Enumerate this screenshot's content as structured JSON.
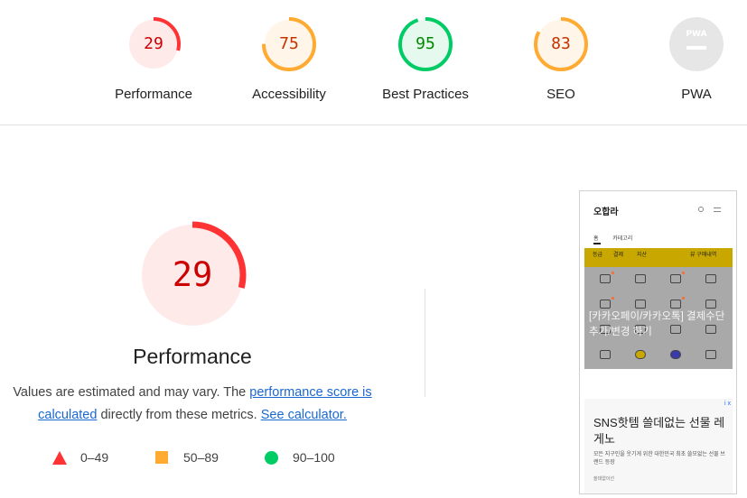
{
  "scores": [
    {
      "label": "Performance",
      "value": "29",
      "fraction": 0.29,
      "color": "#ff3333",
      "text_color": "#cc0000",
      "bg": "#ffeaea"
    },
    {
      "label": "Accessibility",
      "value": "75",
      "fraction": 0.75,
      "color": "#ffaa33",
      "text_color": "#c33300",
      "bg": "#fff5e8"
    },
    {
      "label": "Best Practices",
      "value": "95",
      "fraction": 0.95,
      "color": "#00cc66",
      "text_color": "#008800",
      "bg": "#e6f9ee"
    },
    {
      "label": "SEO",
      "value": "83",
      "fraction": 0.83,
      "color": "#ffaa33",
      "text_color": "#c33300",
      "bg": "#fff5e8"
    },
    {
      "label": "PWA",
      "value": "PWA",
      "fraction": 0,
      "color": "#9e9e9e",
      "text_color": "#ffffff",
      "bg": "#e6e6e6"
    }
  ],
  "main": {
    "score": "29",
    "fraction": 0.29,
    "title": "Performance",
    "desc_before": "Values are estimated and may vary. The ",
    "link_score": "performance score is calculated",
    "desc_mid": " directly from these metrics. ",
    "link_calc": "See calculator."
  },
  "legend": [
    {
      "shape": "triangle",
      "label": "0–49",
      "color": "#ff3333"
    },
    {
      "shape": "square",
      "label": "50–89",
      "color": "#ffaa33"
    },
    {
      "shape": "circle",
      "label": "90–100",
      "color": "#00cc66"
    }
  ],
  "screenshot": {
    "logo": "오합라",
    "nav": [
      "홈",
      "카테고리"
    ],
    "bar_items": [
      "등급",
      "결제",
      "지산",
      "뷰 구매내역"
    ],
    "overlay": "[카카오페이/카카오톡] 결제수단 추가/변경 하기",
    "ad_flag": "i x",
    "ad_title": "SNS핫템 쓸데없는 선물 레게노",
    "ad_text": "모든 지구인을 웃기게 위한 대한민국 최초 쓸모없는 선물 브랜드 등장",
    "ad_small": "쓸데없이선"
  }
}
